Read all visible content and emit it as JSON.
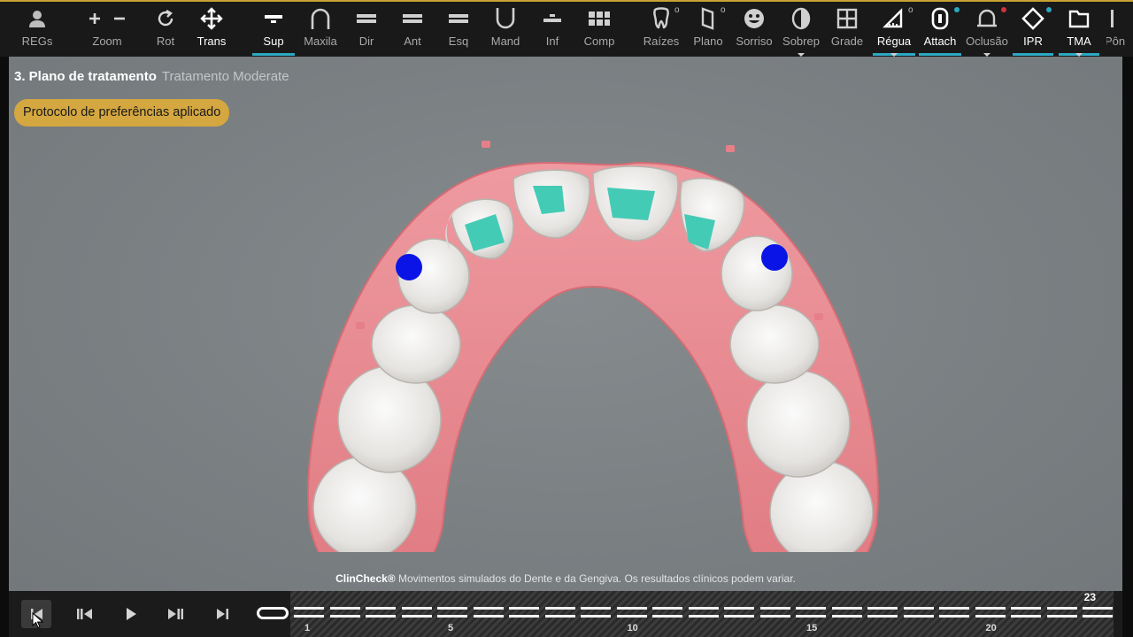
{
  "toolbar": {
    "items": [
      {
        "label": "REGs",
        "icon": "person-icon"
      },
      {
        "label": "Zoom",
        "icon": "zoom-plus-minus-icon"
      },
      {
        "label": "Rot",
        "icon": "rotate-icon"
      },
      {
        "label": "Trans",
        "icon": "move-arrows-icon",
        "active": true
      },
      {
        "label": "Sup",
        "icon": "upper-arch-icon",
        "active": true,
        "selected": true
      },
      {
        "label": "Maxila",
        "icon": "maxilla-arch-icon"
      },
      {
        "label": "Dir",
        "icon": "right-view-icon"
      },
      {
        "label": "Ant",
        "icon": "anterior-view-icon"
      },
      {
        "label": "Esq",
        "icon": "left-view-icon"
      },
      {
        "label": "Mand",
        "icon": "mandible-arch-icon"
      },
      {
        "label": "Inf",
        "icon": "lower-arch-icon"
      },
      {
        "label": "Comp",
        "icon": "compare-grid-icon"
      },
      {
        "label": "Raízes",
        "icon": "tooth-roots-icon",
        "marker": "o"
      },
      {
        "label": "Plano",
        "icon": "plane-icon",
        "marker": "o"
      },
      {
        "label": "Sorriso",
        "icon": "smile-icon"
      },
      {
        "label": "Sobrep",
        "icon": "overlay-icon",
        "caret": true
      },
      {
        "label": "Grade",
        "icon": "grid-icon"
      },
      {
        "label": "Régua",
        "icon": "ruler-icon",
        "marker": "o",
        "active": true,
        "selected": true,
        "caret": true
      },
      {
        "label": "Attach",
        "icon": "attachment-icon",
        "active": true,
        "selected": true,
        "dot": "#2ca8c2"
      },
      {
        "label": "Oclusão",
        "icon": "occlusion-icon",
        "caret": true,
        "dot": "#d0333b"
      },
      {
        "label": "IPR",
        "icon": "ipr-diamond-icon",
        "active": true,
        "selected": true,
        "dot": "#2ca8c2"
      },
      {
        "label": "TMA",
        "icon": "folder-icon",
        "active": true,
        "selected": true,
        "caret": true
      },
      {
        "label": "Pôn",
        "icon": "pontic-icon"
      }
    ]
  },
  "viewport": {
    "step_title": "3. Plano de tratamento",
    "step_subtitle": "Tratamento Moderate",
    "protocol_badge": "Protocolo de preferências aplicado",
    "disclaimer_brand": "ClinCheck®",
    "disclaimer_text": " Movimentos simulados do Dente e da Gengiva. Os resultados clínicos podem variar."
  },
  "playbar": {
    "controls": [
      "first-step-icon",
      "previous-step-icon",
      "play-icon",
      "next-step-icon",
      "last-step-icon"
    ],
    "current_stage": 0,
    "total_stages": "23",
    "tick_labels": [
      "1",
      "5",
      "10",
      "15",
      "20"
    ]
  },
  "colors": {
    "accent": "#2ca8c2",
    "badge": "#d4a740",
    "gum": "#e8868d",
    "attachment": "#44cbb5",
    "marker": "#0a14e6"
  }
}
